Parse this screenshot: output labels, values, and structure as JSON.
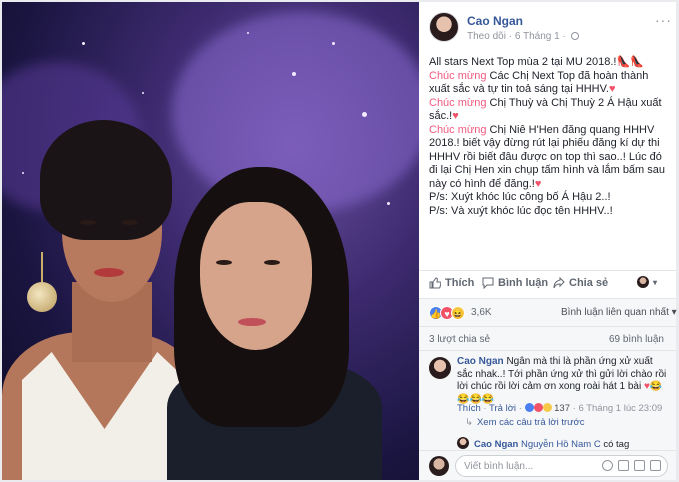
{
  "post": {
    "author": "Cao Ngan",
    "follow_label": "Theo dõi",
    "date": "6 Tháng 1",
    "more_label": "···",
    "paragraphs": [
      {
        "highlight": "",
        "text": "All stars Next Top mùa 2 tại MU 2018.!",
        "suffix": "👠👠"
      },
      {
        "highlight": "Chúc mừng",
        "text": " Các Chị Next Top đã hoàn thành xuất sắc và tự tin toả sáng tại HHHV.",
        "suffix": "♥"
      },
      {
        "highlight": "Chúc mừng",
        "text": " Chị Thuỳ và Chị Thuỳ 2 Á Hậu xuất sắc.!",
        "suffix": "♥"
      },
      {
        "highlight": "Chúc mừng",
        "text": " Chị Niê H'Hen đăng quang HHHV 2018.! biết vậy đừng rút lại phiếu đăng kí dự thi HHHV rồi biết đâu được on top thì sao..! Lúc đó đi lại Chị Hen xin chụp tấm hình và lắm bấm sau này có hình để đăng.!",
        "suffix": "♥"
      },
      {
        "highlight": "",
        "text": "P/s: Xuýt khóc lúc công bố Á Hậu 2..!",
        "suffix": ""
      },
      {
        "highlight": "",
        "text": "P/s: Và xuýt khóc lúc đọc tên HHHV..!",
        "suffix": ""
      }
    ]
  },
  "actions": {
    "like": "Thích",
    "comment": "Bình luận",
    "share": "Chia sẻ"
  },
  "reactions": {
    "count": "3,6K",
    "filter_label": "Bình luận liên quan nhất ▾"
  },
  "stats": {
    "shares": "3 lượt chia sẻ",
    "comments": "69 bình luận"
  },
  "comment": {
    "author": "Cao Ngan",
    "text": "Ngân mà thi là phần ứng xử xuất sắc nhak..! Tới phần ứng xử thì gửi lời chào rồi lời chúc rồi lời cảm ơn xong roài hát 1 bài",
    "emojis": "♥😂😂😂😂",
    "like_label": "Thích",
    "reply_label": "Trả lời",
    "reaction_count": "137",
    "time": "6 Tháng 1 lúc 23:09",
    "view_more": "Xem các câu trả lời trước",
    "reply_author": "Cao Ngan",
    "reply_tag": "Nguyễn Hồ Nam C",
    "reply_text": "có tag"
  },
  "write": {
    "placeholder": "Viết bình luận..."
  },
  "colors": {
    "link": "#365899",
    "highlight": "#f05a7e",
    "heart": "#f25268"
  }
}
